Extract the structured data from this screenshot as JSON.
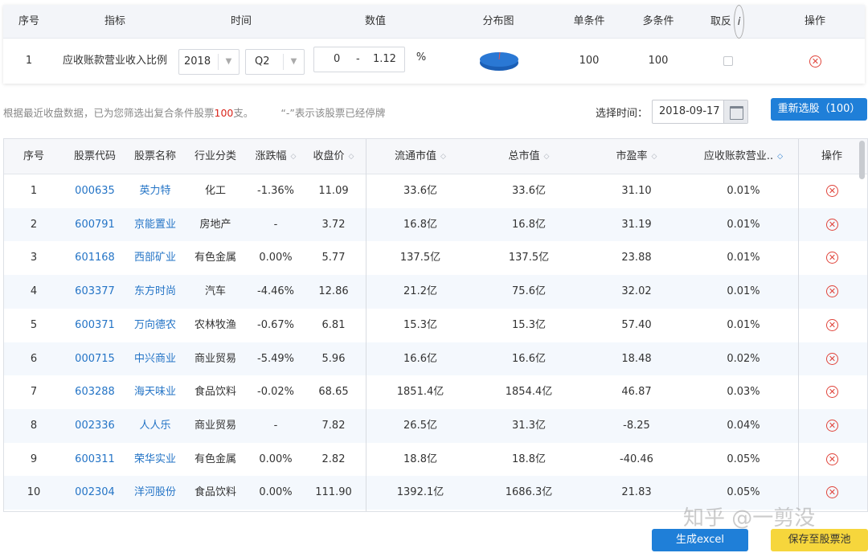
{
  "condition_table": {
    "headers": {
      "index": "序号",
      "indicator": "指标",
      "time": "时间",
      "value": "数值",
      "distribution": "分布图",
      "single": "单条件",
      "multi": "多条件",
      "invert": "取反",
      "action": "操作"
    },
    "row": {
      "index": "1",
      "indicator": "应收账款营业收入比例",
      "year": "2018",
      "quarter": "Q2",
      "range_min": "0",
      "range_sep": "-",
      "range_max": "1.12",
      "unit": "%",
      "single_count": "100",
      "multi_count": "100"
    },
    "info_icon_glyph": "i",
    "delete_glyph": "✕"
  },
  "filter_info": {
    "prefix": "根据最近收盘数据，已为您筛选出复合条件股票",
    "count": "100",
    "suffix": "支。",
    "suspended_note": "“-”表示该股票已经停牌",
    "time_label": "选择时间：",
    "date": "2018-09-17",
    "reselect_button": "重新选股（100）"
  },
  "results_table": {
    "headers": {
      "index": "序号",
      "code": "股票代码",
      "name": "股票名称",
      "industry": "行业分类",
      "change": "涨跌幅",
      "close": "收盘价",
      "float_cap": "流通市值",
      "total_cap": "总市值",
      "pe": "市盈率",
      "ratio": "应收账款营业..",
      "action": "操作"
    },
    "sort_glyph": "◇",
    "delete_glyph": "✕",
    "rows": [
      {
        "index": "1",
        "code": "000635",
        "name": "英力特",
        "industry": "化工",
        "change": "-1.36%",
        "close": "11.09",
        "float_cap": "33.6亿",
        "total_cap": "33.6亿",
        "pe": "31.10",
        "ratio": "0.01%"
      },
      {
        "index": "2",
        "code": "600791",
        "name": "京能置业",
        "industry": "房地产",
        "change": "-",
        "close": "3.72",
        "float_cap": "16.8亿",
        "total_cap": "16.8亿",
        "pe": "31.19",
        "ratio": "0.01%"
      },
      {
        "index": "3",
        "code": "601168",
        "name": "西部矿业",
        "industry": "有色金属",
        "change": "0.00%",
        "close": "5.77",
        "float_cap": "137.5亿",
        "total_cap": "137.5亿",
        "pe": "23.88",
        "ratio": "0.01%"
      },
      {
        "index": "4",
        "code": "603377",
        "name": "东方时尚",
        "industry": "汽车",
        "change": "-4.46%",
        "close": "12.86",
        "float_cap": "21.2亿",
        "total_cap": "75.6亿",
        "pe": "32.02",
        "ratio": "0.01%"
      },
      {
        "index": "5",
        "code": "600371",
        "name": "万向德农",
        "industry": "农林牧渔",
        "change": "-0.67%",
        "close": "6.81",
        "float_cap": "15.3亿",
        "total_cap": "15.3亿",
        "pe": "57.40",
        "ratio": "0.01%"
      },
      {
        "index": "6",
        "code": "000715",
        "name": "中兴商业",
        "industry": "商业贸易",
        "change": "-5.49%",
        "close": "5.96",
        "float_cap": "16.6亿",
        "total_cap": "16.6亿",
        "pe": "18.48",
        "ratio": "0.02%"
      },
      {
        "index": "7",
        "code": "603288",
        "name": "海天味业",
        "industry": "食品饮料",
        "change": "-0.02%",
        "close": "68.65",
        "float_cap": "1851.4亿",
        "total_cap": "1854.4亿",
        "pe": "46.87",
        "ratio": "0.03%"
      },
      {
        "index": "8",
        "code": "002336",
        "name": "人人乐",
        "industry": "商业贸易",
        "change": "-",
        "close": "7.82",
        "float_cap": "26.5亿",
        "total_cap": "31.3亿",
        "pe": "-8.25",
        "ratio": "0.04%"
      },
      {
        "index": "9",
        "code": "600311",
        "name": "荣华实业",
        "industry": "有色金属",
        "change": "0.00%",
        "close": "2.82",
        "float_cap": "18.8亿",
        "total_cap": "18.8亿",
        "pe": "-40.46",
        "ratio": "0.05%"
      },
      {
        "index": "10",
        "code": "002304",
        "name": "洋河股份",
        "industry": "食品饮料",
        "change": "0.00%",
        "close": "111.90",
        "float_cap": "1392.1亿",
        "total_cap": "1686.3亿",
        "pe": "21.83",
        "ratio": "0.05%"
      }
    ]
  },
  "footer": {
    "excel_button": "生成excel",
    "save_button": "保存至股票池",
    "watermark": "知乎 @一剪没"
  },
  "colors": {
    "primary_blue": "#1f7fd8",
    "link_blue": "#2474c6",
    "highlight_red": "#d9261c",
    "delete_red": "#e0443b",
    "save_yellow": "#f6d63c"
  }
}
